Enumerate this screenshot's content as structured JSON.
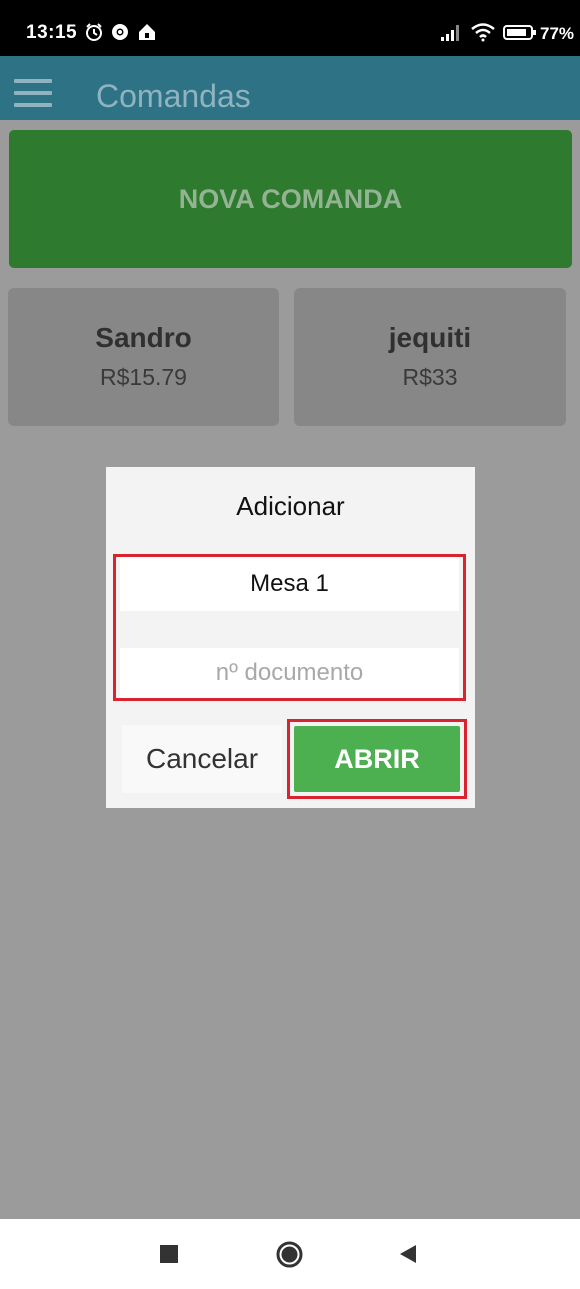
{
  "status_bar": {
    "time": "13:15",
    "battery": "77%",
    "icons": [
      "alarm-icon",
      "chrome-icon",
      "home-app-icon",
      "signal-icon",
      "wifi-icon",
      "battery-icon"
    ]
  },
  "app_bar": {
    "title": "Comandas",
    "menu_icon": "hamburger-menu-icon"
  },
  "main": {
    "new_order_label": "NOVA COMANDA",
    "orders": [
      {
        "name": "Sandro",
        "amount": "R$15.79"
      },
      {
        "name": "jequiti",
        "amount": "R$33"
      }
    ]
  },
  "dialog": {
    "title": "Adicionar",
    "table_value": "Mesa 1",
    "document_placeholder": "nº documento",
    "cancel_label": "Cancelar",
    "open_label": "ABRIR"
  },
  "nav_bar": {
    "icons": [
      "recents-square-icon",
      "home-circle-icon",
      "back-triangle-icon"
    ]
  },
  "colors": {
    "app_bar": "#2e7286",
    "new_order": "#2e7a2f",
    "open_button": "#4caf50",
    "highlight": "#d9232f",
    "overlay": "#9b9b9b"
  }
}
